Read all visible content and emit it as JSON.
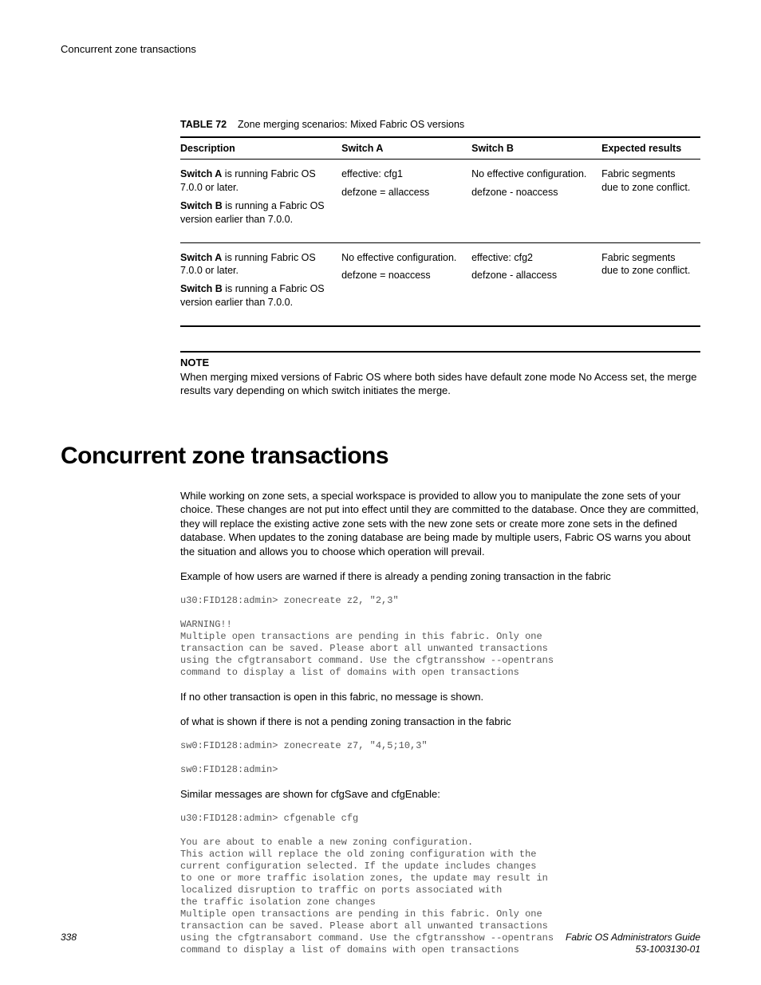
{
  "header": {
    "running_title": "Concurrent zone transactions"
  },
  "table": {
    "caption_label": "TABLE 72",
    "caption_text": "Zone merging scenarios: Mixed Fabric OS versions",
    "headers": {
      "description": "Description",
      "switch_a": "Switch A",
      "switch_b": "Switch B",
      "expected": "Expected results"
    },
    "rows": [
      {
        "desc_1_bold": "Switch A",
        "desc_1_rest": " is running Fabric OS 7.0.0 or later.",
        "desc_2_bold": "Switch B",
        "desc_2_rest": " is running a Fabric OS version earlier than 7.0.0.",
        "switch_a_1": "effective: cfg1",
        "switch_a_2": "defzone = allaccess",
        "switch_b_1": "No effective configuration.",
        "switch_b_2": "defzone - noaccess",
        "expected": "Fabric segments due to zone conflict."
      },
      {
        "desc_1_bold": "Switch A",
        "desc_1_rest": " is running Fabric OS 7.0.0 or later.",
        "desc_2_bold": "Switch B",
        "desc_2_rest": " is running a Fabric OS version earlier than 7.0.0.",
        "switch_a_1": "No effective configuration.",
        "switch_a_2": "defzone = noaccess",
        "switch_b_1": "effective: cfg2",
        "switch_b_2": "defzone - allaccess",
        "expected": "Fabric segments due to zone conflict."
      }
    ]
  },
  "note": {
    "label": "NOTE",
    "text": "When merging mixed versions of Fabric OS where both sides have default zone mode No Access set, the merge results vary depending on which switch initiates the merge."
  },
  "section": {
    "title": "Concurrent zone transactions",
    "para1": "While working on zone sets, a special workspace is provided to allow you to manipulate the zone sets of your choice. These changes are not put into effect until they are committed to the database. Once they are committed, they will replace the existing active zone sets with the new zone sets or create more zone sets in the defined database. When updates to the zoning database are being made by multiple users, Fabric OS warns you about the situation and allows you to choose which operation will prevail.",
    "para2": "Example of how users are warned if there is already a pending zoning transaction in the fabric",
    "code1": "u30:FID128:admin> zonecreate z2, \"2,3\"\n\nWARNING!!\nMultiple open transactions are pending in this fabric. Only one\ntransaction can be saved. Please abort all unwanted transactions\nusing the cfgtransabort command. Use the cfgtransshow --opentrans\ncommand to display a list of domains with open transactions",
    "para3": "If no other transaction is open in this fabric, no message is shown.",
    "para4": "of what is shown if there is not a pending zoning transaction in the fabric",
    "code2": "sw0:FID128:admin> zonecreate z7, \"4,5;10,3\"\n\nsw0:FID128:admin>",
    "para5": "Similar messages are shown for cfgSave and cfgEnable:",
    "code3": "u30:FID128:admin> cfgenable cfg\n\nYou are about to enable a new zoning configuration.\nThis action will replace the old zoning configuration with the\ncurrent configuration selected. If the update includes changes\nto one or more traffic isolation zones, the update may result in\nlocalized disruption to traffic on ports associated with\nthe traffic isolation zone changes\nMultiple open transactions are pending in this fabric. Only one\ntransaction can be saved. Please abort all unwanted transactions\nusing the cfgtransabort command. Use the cfgtransshow --opentrans\ncommand to display a list of domains with open transactions"
  },
  "footer": {
    "page_number": "338",
    "doc_title": "Fabric OS Administrators Guide",
    "doc_number": "53-1003130-01"
  }
}
